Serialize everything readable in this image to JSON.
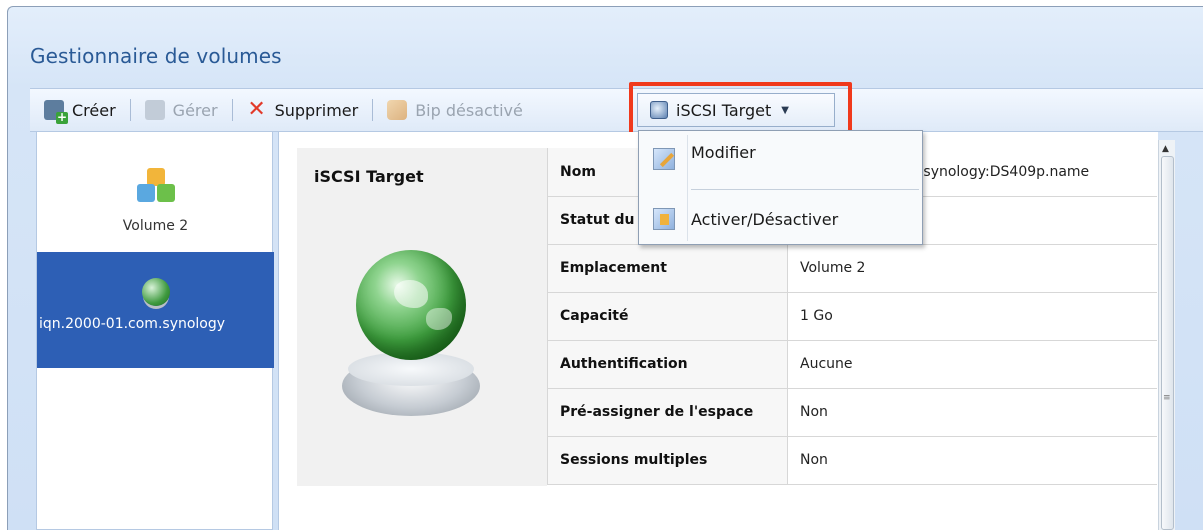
{
  "window": {
    "title": "Gestionnaire de volumes"
  },
  "toolbar": {
    "create_label": "Créer",
    "manage_label": "Gérer",
    "delete_label": "Supprimer",
    "beep_label": "Bip désactivé",
    "iscsi_label": "iSCSI Target"
  },
  "menu": {
    "items": [
      {
        "label": "Modifier",
        "icon": "edit-icon"
      },
      {
        "label": "Activer/Désactiver",
        "icon": "toggle-icon"
      }
    ]
  },
  "volumes": [
    {
      "label": "Volume 2",
      "icon": "cubes-icon",
      "selected": false
    },
    {
      "label": "iqn.2000-01.com.synology",
      "icon": "globe-icon",
      "selected": true
    }
  ],
  "detail": {
    "title": "iSCSI Target",
    "rows": [
      {
        "key": "Nom",
        "value": "iqn.2000-01.com.synology:DS409p.name"
      },
      {
        "key": "Statut du",
        "value": ""
      },
      {
        "key": "Emplacement",
        "value": "Volume 2"
      },
      {
        "key": "Capacité",
        "value": "1 Go"
      },
      {
        "key": "Authentification",
        "value": "Aucune"
      },
      {
        "key": "Pré-assigner de l'espace",
        "value": "Non"
      },
      {
        "key": "Sessions multiples",
        "value": "Non"
      }
    ]
  },
  "colors": {
    "title": "#2a5a96",
    "selection": "#2d5fb5",
    "highlight": "#f0391c"
  }
}
